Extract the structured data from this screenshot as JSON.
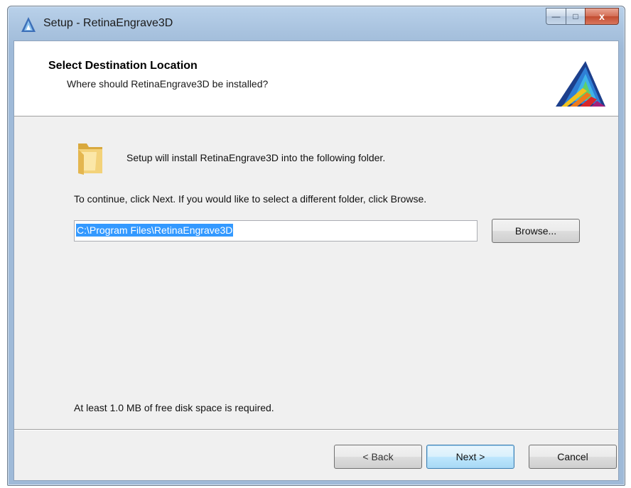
{
  "window": {
    "title": "Setup - RetinaEngrave3D",
    "caption": {
      "minimize": "—",
      "maximize": "□",
      "close": "x"
    }
  },
  "header": {
    "title": "Select Destination Location",
    "subtitle": "Where should RetinaEngrave3D be installed?",
    "logo_icon": "retinaengrave-prism-logo-icon"
  },
  "body": {
    "folder_icon": "folder-icon",
    "intro": "Setup will install RetinaEngrave3D into the following folder.",
    "instruction": "To continue, click Next. If you would like to select a different folder, click Browse.",
    "path_value": "C:\\Program Files\\RetinaEngrave3D",
    "browse_label": "Browse...",
    "disk_space": "At least 1.0 MB of free disk space is required."
  },
  "footer": {
    "back_label": "< Back",
    "next_label": "Next >",
    "cancel_label": "Cancel"
  },
  "colors": {
    "selection": "#3399ff",
    "close_button": "#c24c30",
    "default_button_border": "#3c7fb1"
  }
}
